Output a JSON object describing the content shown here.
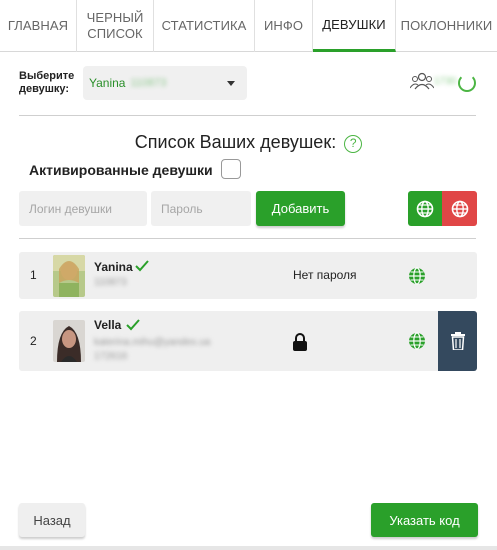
{
  "tabs": [
    {
      "label": "ГЛАВНАЯ",
      "active": false
    },
    {
      "label": "ЧЕРНЫЙ\nСПИСОК",
      "active": false
    },
    {
      "label": "СТАТИСТИКА",
      "active": false
    },
    {
      "label": "ИНФО",
      "active": false
    },
    {
      "label": "ДЕВУШКИ",
      "active": true
    },
    {
      "label": "ПОКЛОННИКИ",
      "active": false
    }
  ],
  "selector": {
    "label": "Выберите девушку:",
    "selected_name": "Yanina",
    "selected_id": "110873"
  },
  "fans": {
    "icon": "users-icon",
    "count": "1730"
  },
  "list": {
    "title": "Список Ваших девушек:",
    "help": "?",
    "activated_label": "Активированные девушки",
    "activated_checked": false
  },
  "add_form": {
    "login_placeholder": "Логин девушки",
    "password_placeholder": "Пароль",
    "add_button": "Добавить"
  },
  "girls": [
    {
      "num": "1",
      "name": "Yanina",
      "id": "110873",
      "email": "",
      "password_status": "Нет пароля",
      "has_lock": false
    },
    {
      "num": "2",
      "name": "Vella",
      "id": "172616",
      "email": "katerina.mihu@yandex.ua",
      "password_status": "",
      "has_lock": true
    }
  ],
  "buttons": {
    "back": "Назад",
    "set_code": "Указать код"
  },
  "colors": {
    "green": "#2aa02a",
    "red": "#e04646",
    "dark": "#34495e"
  }
}
